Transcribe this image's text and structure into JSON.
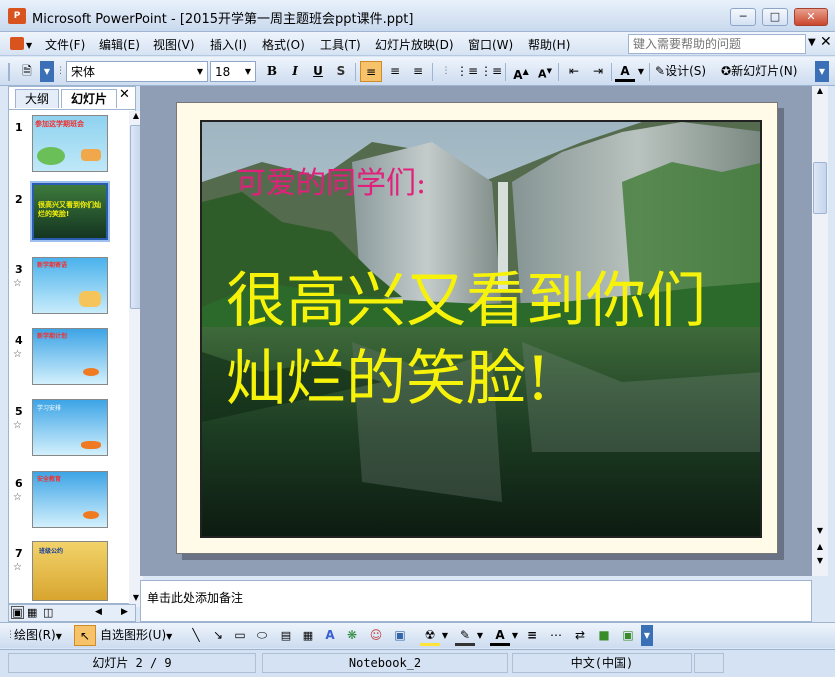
{
  "window": {
    "title": "Microsoft PowerPoint - [2015开学第一周主题班会ppt课件.ppt]",
    "app_icon": "P"
  },
  "menu": {
    "items": [
      "文件(F)",
      "编辑(E)",
      "视图(V)",
      "插入(I)",
      "格式(O)",
      "工具(T)",
      "幻灯片放映(D)",
      "窗口(W)",
      "帮助(H)"
    ],
    "help_placeholder": "键入需要帮助的问题"
  },
  "toolbar": {
    "font_name": "宋体",
    "font_size": "18",
    "bold": "B",
    "italic": "I",
    "underline": "U",
    "shadow": "S",
    "design_label": "设计(S)",
    "new_slide_label": "新幻灯片(N)"
  },
  "left_pane": {
    "tabs": [
      "大纲",
      "幻灯片"
    ],
    "slides": [
      {
        "num": "1",
        "starred": false,
        "title": "参加这学期班会",
        "bg": "#8fd2f0"
      },
      {
        "num": "2",
        "starred": false,
        "title": "很高兴又看到你们灿烂的笑脸!",
        "bg": "#1f4d2a"
      },
      {
        "num": "3",
        "starred": true,
        "title": "新学期寄语",
        "bg": "#5cb8ec"
      },
      {
        "num": "4",
        "starred": true,
        "title": "新学期计划",
        "bg": "#56b4ea"
      },
      {
        "num": "5",
        "starred": true,
        "title": "学习安排",
        "bg": "#4fb0e8"
      },
      {
        "num": "6",
        "starred": true,
        "title": "安全教育",
        "bg": "#58b6ea"
      },
      {
        "num": "7",
        "starred": true,
        "title": "班级公约",
        "bg": "#e8c24a"
      }
    ]
  },
  "slide": {
    "subtitle": "可爱的同学们:",
    "headline_line1": "很高兴又看到你们",
    "headline_line2": "灿烂的笑脸!",
    "subtitle_color": "#e0207a",
    "headline_color": "#f6f20a"
  },
  "notes": {
    "placeholder": "单击此处添加备注"
  },
  "drawbar": {
    "draw_label": "绘图(R)",
    "autoshape_label": "自选图形(U)"
  },
  "status": {
    "slide_info": "幻灯片 2 / 9",
    "template": "Notebook_2",
    "language": "中文(中国)"
  }
}
